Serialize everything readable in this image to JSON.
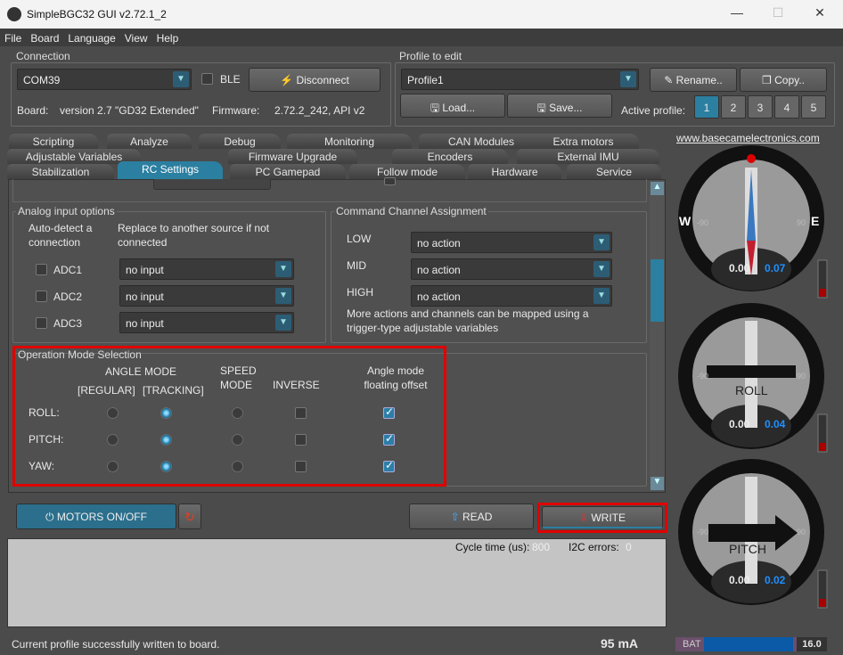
{
  "window": {
    "title": "SimpleBGC32 GUI v2.72.1_2",
    "minimize": "—",
    "maximize": "☐",
    "close": "✕"
  },
  "menu": [
    "File",
    "Board",
    "Language",
    "View",
    "Help"
  ],
  "connection": {
    "label": "Connection",
    "port": "COM39",
    "ble": "BLE",
    "disconnect": "Disconnect",
    "board_label": "Board:",
    "board": "version 2.7 \"GD32 Extended\"",
    "firmware_label": "Firmware:",
    "firmware": "2.72.2_242, API v2"
  },
  "profile": {
    "label": "Profile to edit",
    "current": "Profile1",
    "rename": "Rename..",
    "copy": "Copy..",
    "load": "Load...",
    "save": "Save...",
    "active_label": "Active profile:",
    "profiles": [
      "1",
      "2",
      "3",
      "4",
      "5"
    ],
    "active": "1"
  },
  "tabs": {
    "row1": [
      "Scripting",
      "Analyze",
      "Debug",
      "Monitoring",
      "CAN Modules",
      "Extra motors"
    ],
    "row2": [
      "Adjustable Variables",
      "Firmware Upgrade",
      "Encoders",
      "External IMU"
    ],
    "row3": [
      "Stabilization",
      "RC Settings",
      "PC Gamepad",
      "Follow mode",
      "Hardware",
      "Service"
    ],
    "active": "RC Settings"
  },
  "analog": {
    "title": "Analog input options",
    "col1": "Auto-detect a connection",
    "col2": "Replace to another source if not connected",
    "rows": [
      {
        "label": "ADC1",
        "value": "no input"
      },
      {
        "label": "ADC2",
        "value": "no input"
      },
      {
        "label": "ADC3",
        "value": "no input"
      }
    ]
  },
  "command": {
    "title": "Command Channel Assignment",
    "rows": [
      {
        "label": "LOW",
        "value": "no action"
      },
      {
        "label": "MID",
        "value": "no action"
      },
      {
        "label": "HIGH",
        "value": "no action"
      }
    ],
    "note": "More actions and channels can be mapped using a trigger-type adjustable variables"
  },
  "opmode": {
    "title": "Operation Mode Selection",
    "h_angle": "ANGLE MODE",
    "h_regular": "[REGULAR]",
    "h_tracking": "[TRACKING]",
    "h_speed": "SPEED MODE",
    "h_inverse": "INVERSE",
    "h_float": "Angle mode floating offset",
    "rows": [
      {
        "label": "ROLL:",
        "mode": "tracking",
        "inverse": false,
        "floating": true
      },
      {
        "label": "PITCH:",
        "mode": "tracking",
        "inverse": false,
        "floating": true
      },
      {
        "label": "YAW:",
        "mode": "tracking",
        "inverse": false,
        "floating": true
      }
    ]
  },
  "buttons": {
    "motors": "MOTORS ON/OFF",
    "read": "READ",
    "write": "WRITE"
  },
  "log": {
    "cycle_label": "Cycle time (us):",
    "cycle": "800",
    "i2c_label": "I2C errors:",
    "i2c": "0"
  },
  "status": {
    "message": "Current profile successfully written to board.",
    "current": "95 mA",
    "bat_label": "BAT",
    "bat_value": "16.0"
  },
  "gauges": {
    "link": "www.basecamelectronics.com",
    "yaw": {
      "w": "W",
      "e": "E",
      "left": "-90",
      "right": "90",
      "v1": "0.00",
      "v2": "0.07"
    },
    "roll": {
      "label": "ROLL",
      "left": "-90",
      "right": "90",
      "v1": "0.00",
      "v2": "0.04"
    },
    "pitch": {
      "label": "PITCH",
      "left": "-90",
      "right": "90",
      "v1": "0.00",
      "v2": "0.02"
    }
  },
  "colors": {
    "accent": "#2b7fa0",
    "highlight": "#e00000",
    "value_blue": "#1e90ff"
  }
}
